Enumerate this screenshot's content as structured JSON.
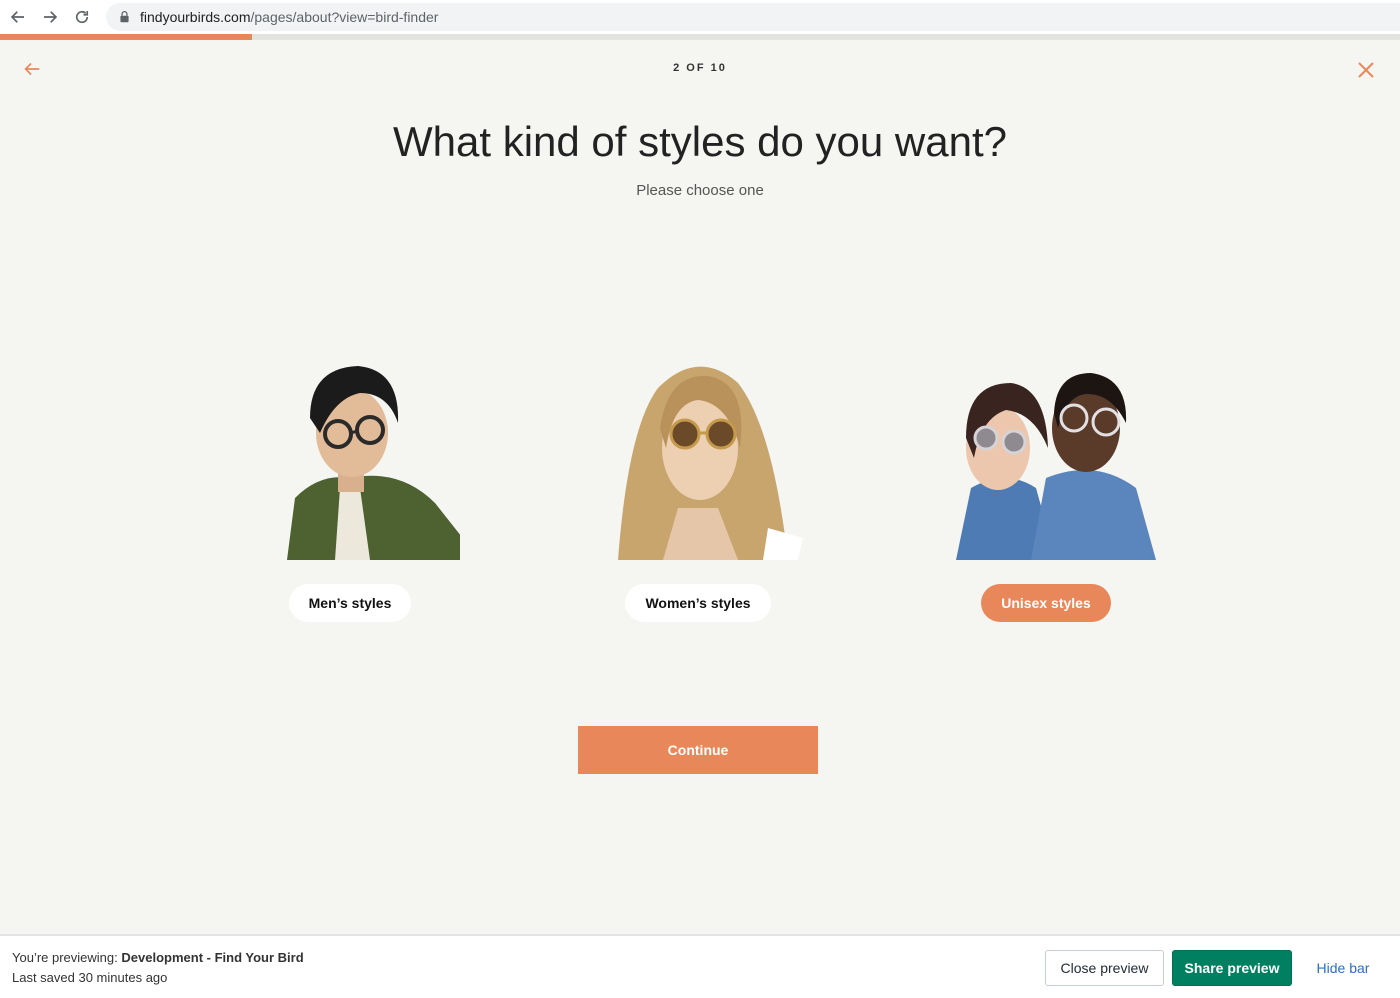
{
  "browser": {
    "url_host": "findyourbirds.com",
    "url_path": "/pages/about?view=bird-finder"
  },
  "quiz": {
    "step_label": "2 OF 10",
    "progress": 0.18,
    "title": "What kind of styles do you want?",
    "subtitle": "Please choose one",
    "options": [
      {
        "label": "Men’s styles",
        "selected": false
      },
      {
        "label": "Women’s styles",
        "selected": false
      },
      {
        "label": "Unisex styles",
        "selected": true
      }
    ],
    "continue_label": "Continue"
  },
  "preview_bar": {
    "previewing_prefix": "You’re previewing:",
    "theme_name": "Development - Find Your Bird",
    "last_saved": "Last saved 30 minutes ago",
    "close_label": "Close preview",
    "share_label": "Share preview",
    "hide_label": "Hide bar"
  },
  "colors": {
    "accent": "#e8885a",
    "share_green": "#008060",
    "link_blue": "#2c6ecb"
  },
  "icons": {
    "back": "arrow-left-icon",
    "forward": "arrow-right-icon",
    "reload": "reload-icon",
    "lock": "lock-icon",
    "quiz_back": "arrow-left-icon",
    "quiz_close": "close-icon"
  }
}
